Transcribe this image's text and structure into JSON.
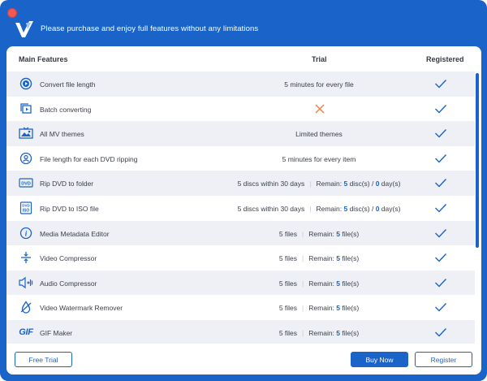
{
  "header": {
    "title": "Please purchase and enjoy full features without any limitations"
  },
  "table": {
    "col_feature": "Main Features",
    "col_trial": "Trial",
    "col_registered": "Registered",
    "rows": [
      {
        "name": "Convert file length",
        "icon": "play-circle-icon",
        "trial": "5 minutes for every file",
        "registered": true
      },
      {
        "name": "Batch converting",
        "icon": "batch-icon",
        "trial_unavailable": true,
        "registered": true
      },
      {
        "name": "All MV themes",
        "icon": "mv-theme-icon",
        "trial": "Limited themes",
        "registered": true
      },
      {
        "name": "File length for each DVD ripping",
        "icon": "dvd-disc-icon",
        "trial": "5 minutes for every item",
        "registered": true
      },
      {
        "name": "Rip DVD to folder",
        "icon": "dvd-folder-icon",
        "trial_a": "5 discs within 30 days",
        "trial_b_prefix": "Remain: ",
        "trial_b_num1": "5",
        "trial_b_mid": " disc(s) / ",
        "trial_b_num2": "0",
        "trial_b_suffix": " day(s)",
        "registered": true
      },
      {
        "name": "Rip DVD to ISO file",
        "icon": "dvd-iso-icon",
        "trial_a": "5 discs within 30 days",
        "trial_b_prefix": "Remain: ",
        "trial_b_num1": "5",
        "trial_b_mid": " disc(s) / ",
        "trial_b_num2": "0",
        "trial_b_suffix": " day(s)",
        "registered": true
      },
      {
        "name": "Media Metadata Editor",
        "icon": "info-icon",
        "trial_a": "5 files",
        "trial_b_prefix": "Remain: ",
        "trial_b_num1": "5",
        "trial_b_suffix": " file(s)",
        "registered": true
      },
      {
        "name": "Video Compressor",
        "icon": "compress-icon",
        "trial_a": "5 files",
        "trial_b_prefix": "Remain: ",
        "trial_b_num1": "5",
        "trial_b_suffix": " file(s)",
        "registered": true
      },
      {
        "name": "Audio Compressor",
        "icon": "audio-compress-icon",
        "trial_a": "5 files",
        "trial_b_prefix": "Remain: ",
        "trial_b_num1": "5",
        "trial_b_suffix": " file(s)",
        "registered": true
      },
      {
        "name": "Video Watermark Remover",
        "icon": "watermark-remove-icon",
        "trial_a": "5 files",
        "trial_b_prefix": "Remain: ",
        "trial_b_num1": "5",
        "trial_b_suffix": " file(s)",
        "registered": true
      },
      {
        "name": "GIF Maker",
        "icon": "gif-icon",
        "icon_text": "GIF",
        "trial_a": "5 files",
        "trial_b_prefix": "Remain: ",
        "trial_b_num1": "5",
        "trial_b_suffix": " file(s)",
        "registered": true
      }
    ]
  },
  "footer": {
    "free_trial": "Free Trial",
    "buy_now": "Buy Now",
    "register": "Register"
  },
  "colors": {
    "accent": "#1a63c9",
    "row_alt": "#eef0f5",
    "cross": "#ef7b45"
  }
}
